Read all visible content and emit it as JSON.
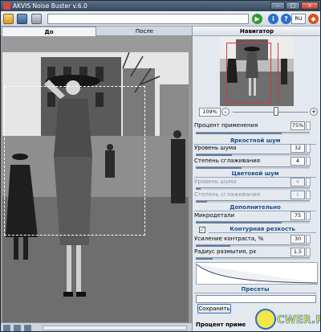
{
  "window": {
    "title": "AKVIS Noise Buster v.6.0",
    "controls": {
      "minimize": "–",
      "maximize": "□",
      "close": "×"
    }
  },
  "toolbar": {
    "path_value": "",
    "lang_label": "RU",
    "icons": [
      "open-icon",
      "save-icon",
      "print-icon",
      "run-icon",
      "info-icon",
      "help-icon",
      "home-icon"
    ]
  },
  "tabs": [
    {
      "label": "До",
      "active": true
    },
    {
      "label": "После",
      "active": false
    }
  ],
  "navigator": {
    "title": "Навигатор",
    "zoom": "109%",
    "zoom_minus": "–",
    "zoom_plus": "+"
  },
  "settings": {
    "apply_percent": {
      "label": "Процент применения",
      "value": "75%",
      "fraction": 0.75
    },
    "luminance_group": "Яркостной шум",
    "lum_noise": {
      "label": "Уровень шума",
      "value": "32",
      "fraction": 0.32
    },
    "lum_smooth": {
      "label": "Степень сглаживания",
      "value": "4",
      "fraction": 0.4
    },
    "color_group": "Цветовой шум",
    "color_noise": {
      "label": "Уровень шума",
      "value": "4",
      "fraction": 0.04
    },
    "color_smooth": {
      "label": "Степень сглаживания",
      "value": "1",
      "fraction": 0.1
    },
    "extra_group": "Дополнительно",
    "microdetail": {
      "label": "Микродетали",
      "value": "75",
      "fraction": 0.75
    },
    "edge_sharpness": {
      "label": "Контурная резкость",
      "checked": true
    },
    "contrast_gain": {
      "label": "Усиление контраста, %",
      "value": "30",
      "fraction": 0.3
    },
    "blur_radius": {
      "label": "Радиус размытия, px",
      "value": "1,5",
      "fraction": 0.15
    }
  },
  "presets": {
    "title": "Пресеты",
    "selected": "",
    "save_label": "Сохранить"
  },
  "footer": {
    "label": "Процент приме"
  },
  "watermark": {
    "text": "CWER.RU"
  },
  "colors": {
    "titlebar": "#34465b",
    "panel": "#e4e9ef",
    "group_heading": "#1d4e8a",
    "accent_red": "#d43a3a"
  }
}
